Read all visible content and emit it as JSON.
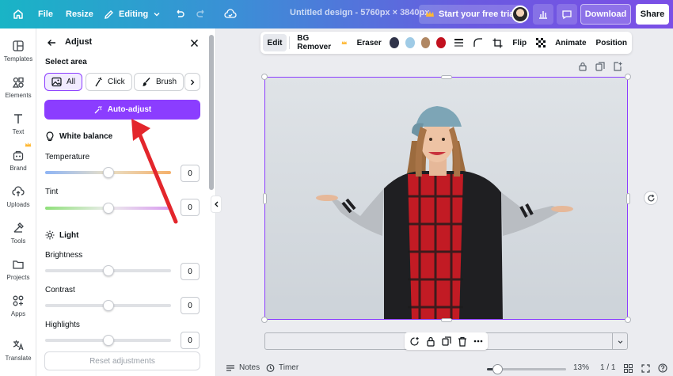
{
  "topbar": {
    "file": "File",
    "resize": "Resize",
    "editing": "Editing",
    "title": "Untitled design - 5760px × 3840px",
    "trial": "Start your free trial",
    "download": "Download",
    "share": "Share"
  },
  "rail": {
    "items": [
      {
        "label": "Templates",
        "icon": "templates-icon"
      },
      {
        "label": "Elements",
        "icon": "elements-icon"
      },
      {
        "label": "Text",
        "icon": "text-icon"
      },
      {
        "label": "Brand",
        "icon": "brand-icon"
      },
      {
        "label": "Uploads",
        "icon": "uploads-icon"
      },
      {
        "label": "Tools",
        "icon": "tools-icon"
      },
      {
        "label": "Projects",
        "icon": "projects-icon"
      },
      {
        "label": "Apps",
        "icon": "apps-icon"
      },
      {
        "label": "Translate",
        "icon": "translate-icon"
      }
    ]
  },
  "panel": {
    "title": "Adjust",
    "select_area": "Select area",
    "chips": [
      "All",
      "Click",
      "Brush"
    ],
    "auto_adjust": "Auto-adjust",
    "white_balance": "White balance",
    "temperature": "Temperature",
    "temperature_value": "0",
    "tint": "Tint",
    "tint_value": "0",
    "light": "Light",
    "brightness": "Brightness",
    "brightness_value": "0",
    "contrast": "Contrast",
    "contrast_value": "0",
    "highlights": "Highlights",
    "highlights_value": "0",
    "reset": "Reset adjustments"
  },
  "context_toolbar": {
    "edit": "Edit",
    "bg_remover": "BG Remover",
    "eraser": "Eraser",
    "colors": [
      "#2f3349",
      "#9fcbe6",
      "#b08763",
      "#c2111f"
    ],
    "flip": "Flip",
    "animate": "Animate",
    "position": "Position"
  },
  "bottombar": {
    "notes": "Notes",
    "timer": "Timer",
    "zoom": "13%",
    "zoom_fraction": 0.13,
    "pages": "1 / 1"
  }
}
